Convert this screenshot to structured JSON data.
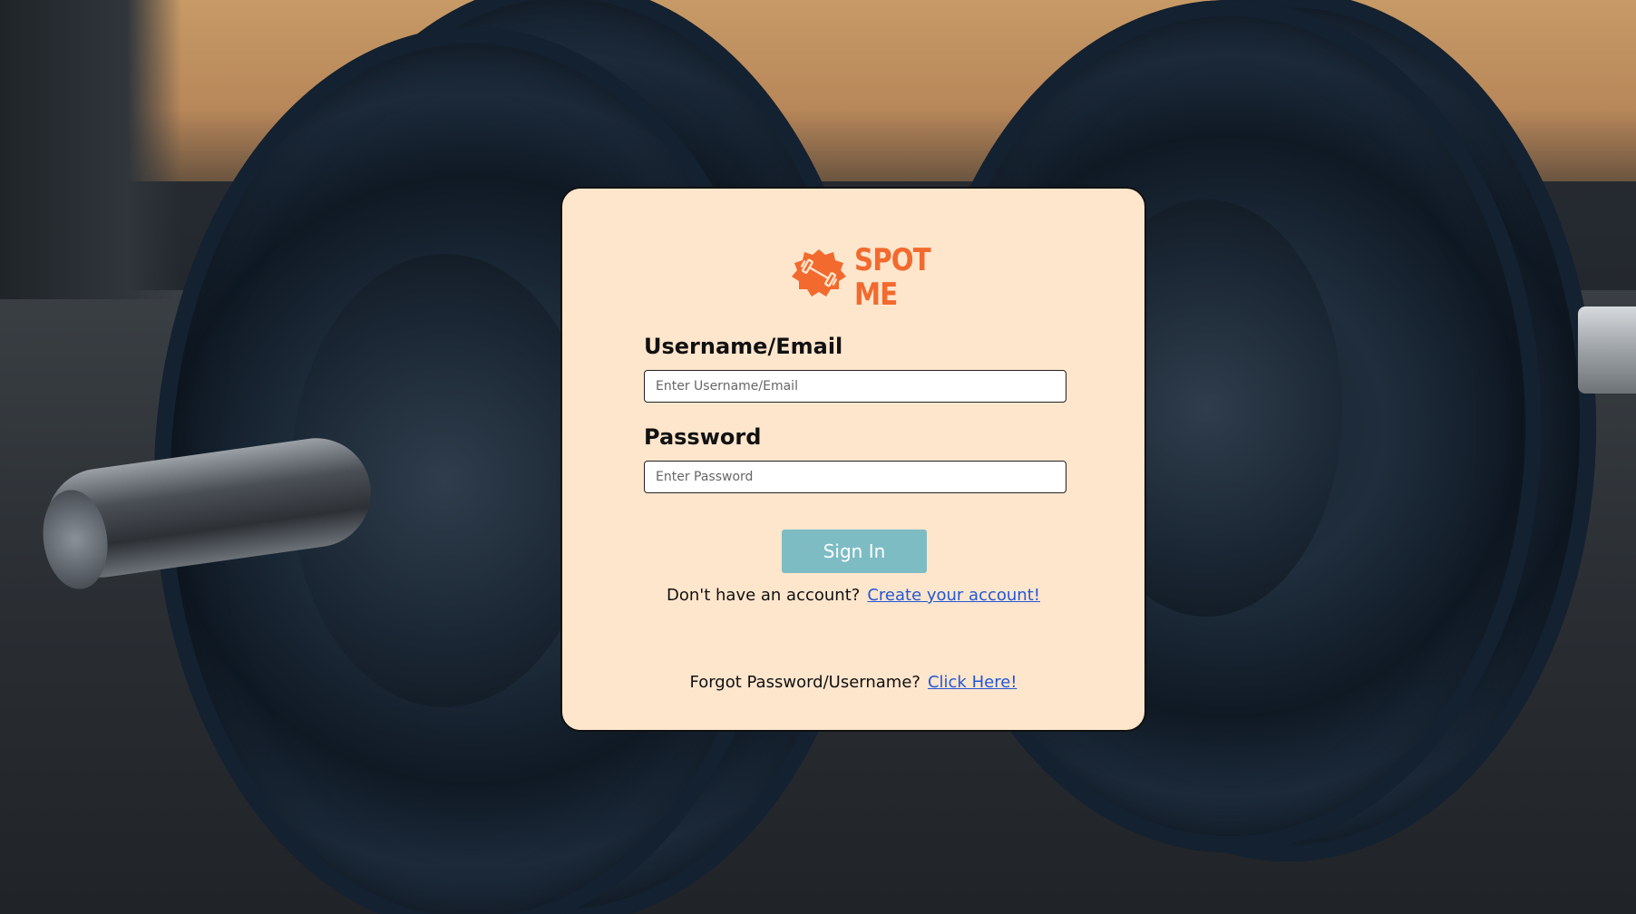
{
  "brand": {
    "line1": "SPOT",
    "line2": "ME",
    "color": "#f26a2e",
    "logo_icon": "dumbbell-badge-icon"
  },
  "form": {
    "username_label": "Username/Email",
    "username_placeholder": "Enter Username/Email",
    "password_label": "Password",
    "password_placeholder": "Enter Password",
    "signin_label": "Sign In"
  },
  "signup": {
    "prompt": "Don't have an account?",
    "link": "Create your account!"
  },
  "forgot": {
    "prompt": "Forgot Password/Username?",
    "link": "Click Here!"
  },
  "colors": {
    "card_background": "#fee6cd",
    "button": "#7ebcc4",
    "link": "#2257d6"
  },
  "background": "dumbbell-photo"
}
